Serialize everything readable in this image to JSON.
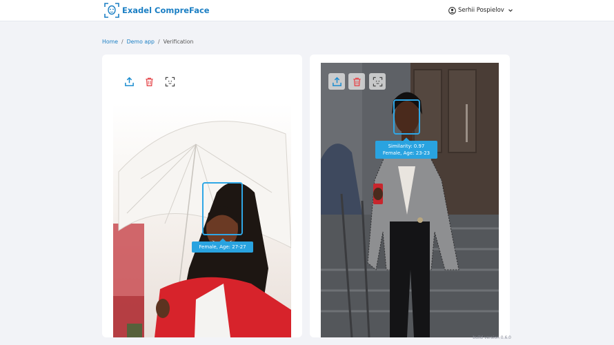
{
  "header": {
    "brand": "Exadel CompreFace",
    "user_name": "Serhii Pospielov",
    "brand_color": "#1b7fc4"
  },
  "breadcrumb": {
    "items": [
      "Home",
      "Demo app"
    ],
    "current": "Verification"
  },
  "left_panel": {
    "toolbar": [
      "upload-icon",
      "delete-icon",
      "face-scan-icon"
    ],
    "face_label": "Female, Age: 27-27"
  },
  "right_panel": {
    "toolbar": [
      "upload-icon",
      "delete-icon",
      "face-scan-icon"
    ],
    "similarity": "Similarity: 0.97",
    "face_label": "Female, Age: 23-23"
  },
  "footer": {
    "version": "build version 0.6.0"
  },
  "colors": {
    "accent": "#29a3e0",
    "delete": "#e5494d",
    "background": "#f2f3f7"
  }
}
